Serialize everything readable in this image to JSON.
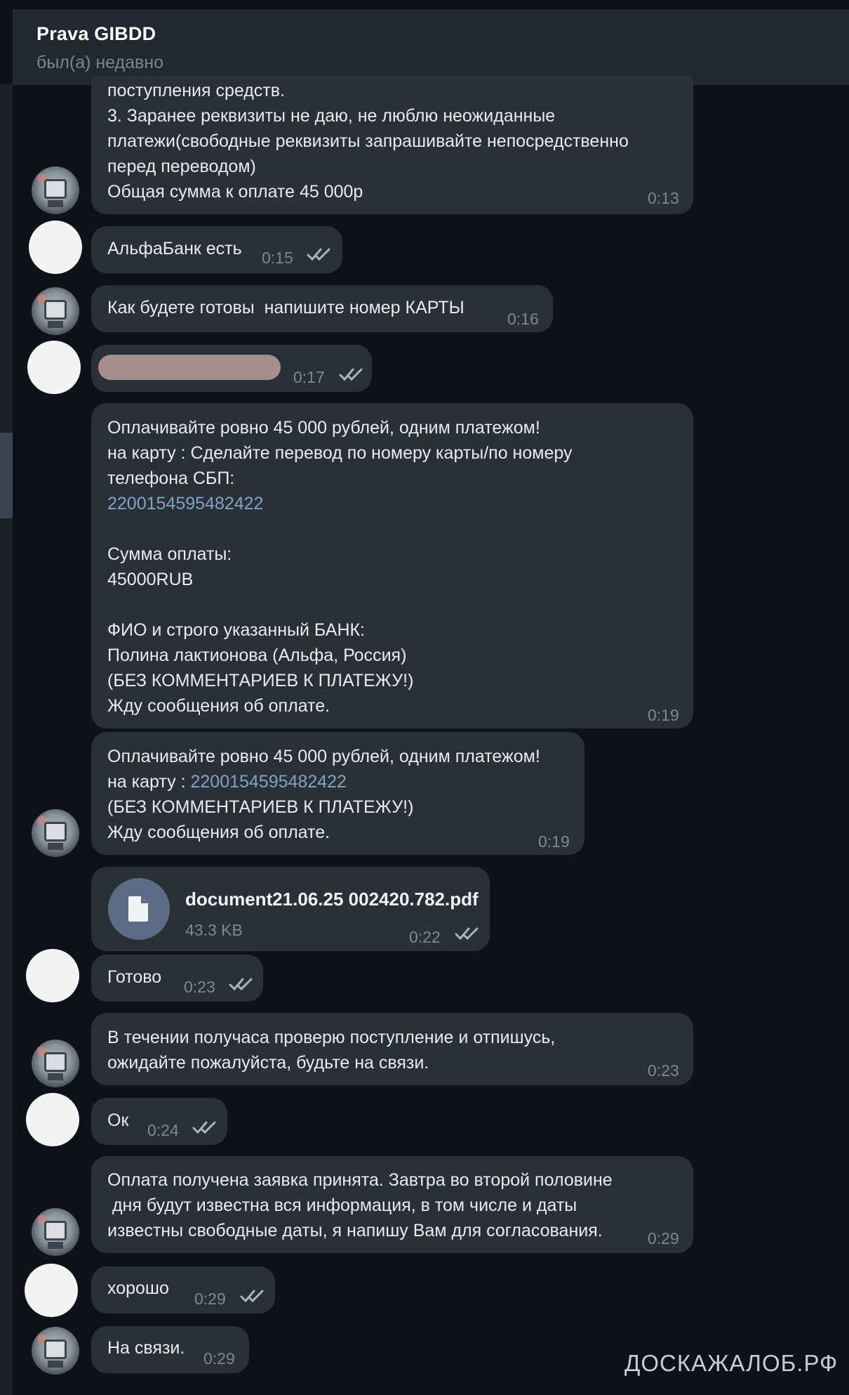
{
  "chat": {
    "title": "Prava GIBDD",
    "status": "был(а) недавно"
  },
  "messages": {
    "m1": {
      "lines": [
        "поступления средств.",
        "3. Заранее реквизиты не даю, не люблю неожиданные",
        "платежи(свободные реквизиты запрашивайте непосредственно",
        "перед переводом)",
        "Общая сумма к оплате 45 000р"
      ],
      "time": "0:13"
    },
    "m2": {
      "text": "АльфаБанк есть",
      "time": "0:15"
    },
    "m3": {
      "text": "Как будете готовы  напишите номер КАРТЫ",
      "time": "0:16"
    },
    "m4": {
      "time": "0:17"
    },
    "m5": {
      "line1": "Оплачивайте ровно 45 000 рублей, одним платежом!",
      "line2": "на карту : Сделайте перевод по номеру карты/по номеру",
      "line3": "телефона СБП:",
      "card": "2200154595482422",
      "line5": "Сумма оплаты:",
      "line6": "45000RUB",
      "line7": "ФИО и строго указанный БАНК:",
      "line8": "Полина лактионова (Альфа, Россия)",
      "line9": "(БЕЗ КОММЕНТАРИЕВ К ПЛАТЕЖУ!)",
      "line10": "Жду сообщения об оплате.",
      "time": "0:19"
    },
    "m6": {
      "line1": "Оплачивайте ровно 45 000 рублей, одним платежом!",
      "prefix": "на карту : ",
      "card": "2200154595482422",
      "line3": "(БЕЗ КОММЕНТАРИЕВ К ПЛАТЕЖУ!)",
      "line4": "Жду сообщения об оплате.",
      "time": "0:19"
    },
    "m7": {
      "file_name": "document21.06.25 002420.782.pdf",
      "file_size": "43.3 KB",
      "time": "0:22"
    },
    "m8": {
      "text": "Готово",
      "time": "0:23"
    },
    "m9": {
      "line1": "В течении получаса проверю поступление и отпишусь,",
      "line2": "ожидайте пожалуйста, будьте на связи.",
      "time": "0:23"
    },
    "m10": {
      "text": "Ок",
      "time": "0:24"
    },
    "m11": {
      "line1": "Оплата получена заявка принята. Завтра во второй половине",
      "line2": " дня будут известна вся информация, в том числе и даты",
      "line3": "известны свободные даты, я напишу Вам для согласования.",
      "time": "0:29"
    },
    "m12": {
      "text": "хорошо",
      "time": "0:29"
    },
    "m13": {
      "text": "На связи.",
      "time": "0:29"
    }
  },
  "watermark": "ДОСКАЖАЛОБ.РФ",
  "icons": {
    "read": "double-check-icon",
    "file": "document-icon"
  },
  "colors": {
    "bubble": "#2b3036",
    "header": "#232830",
    "background": "#0e1118",
    "link": "#7fa3c7",
    "file_icon_bg": "#5c6c84"
  }
}
